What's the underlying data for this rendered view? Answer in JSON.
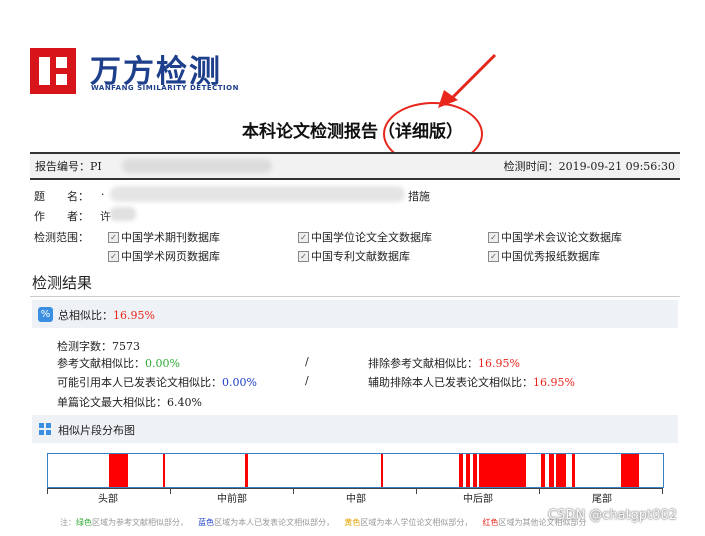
{
  "logo": {
    "cn": "万方检测",
    "en": "WANFANG SIMILARITY DETECTION"
  },
  "title": "本科论文检测报告（详细版）",
  "meta": {
    "report_no_label": "报告编号：PI",
    "check_time_label": "检测时间：",
    "check_time": "2019-09-21 09:56:30"
  },
  "paper": {
    "title_label": "题　　名：",
    "title_visible_prefix": "·",
    "title_visible_suffix": "措施",
    "author_label": "作　　者：",
    "author_visible": "许",
    "scope_label": "检测范围："
  },
  "databases": [
    "中国学术期刊数据库",
    "中国学位论文全文数据库",
    "中国学术会议论文数据库",
    "中国学术网页数据库",
    "中国专利文献数据库",
    "中国优秀报纸数据库"
  ],
  "results": {
    "section_title": "检测结果",
    "total_label": "总相似比：",
    "total_value": "16.95%",
    "char_count_label": "检测字数：",
    "char_count": "7573",
    "ref_label": "参考文献相似比：",
    "ref_value": "0.00%",
    "excl_ref_label": "排除参考文献相似比：",
    "excl_ref_value": "16.95%",
    "self_label": "可能引用本人已发表论文相似比：",
    "self_value": "0.00%",
    "excl_self_label": "辅助排除本人已发表论文相似比：",
    "excl_self_value": "16.95%",
    "max_label": "单篇论文最大相似比：",
    "max_value": "6.40%",
    "slash": "/"
  },
  "distribution": {
    "title": "相似片段分布图",
    "axis_labels": [
      "头部",
      "中前部",
      "中部",
      "中后部",
      "尾部"
    ],
    "segments": [
      {
        "start": 0.099,
        "end": 0.13
      },
      {
        "start": 0.187,
        "end": 0.191
      },
      {
        "start": 0.321,
        "end": 0.325
      },
      {
        "start": 0.541,
        "end": 0.545
      },
      {
        "start": 0.668,
        "end": 0.675
      },
      {
        "start": 0.68,
        "end": 0.687
      },
      {
        "start": 0.691,
        "end": 0.698
      },
      {
        "start": 0.7,
        "end": 0.778
      },
      {
        "start": 0.802,
        "end": 0.808
      },
      {
        "start": 0.815,
        "end": 0.822
      },
      {
        "start": 0.826,
        "end": 0.843
      },
      {
        "start": 0.852,
        "end": 0.857
      },
      {
        "start": 0.931,
        "end": 0.961
      }
    ],
    "colors": {
      "red": "#ff0000",
      "border": "#3a7fc1"
    }
  },
  "legend": {
    "prefix": "注：",
    "green": "绿色",
    "green_text": "区域为参考文献相似部分，",
    "blue": "蓝色",
    "blue_text": "区域为本人已发表论文相似部分，",
    "yellow": "黄色",
    "yellow_text": "区域为本人学位论文相似部分，",
    "red": "红色",
    "red_text": "区域为其他论文相似部分"
  },
  "watermark": "CSDN @chatgpt002"
}
